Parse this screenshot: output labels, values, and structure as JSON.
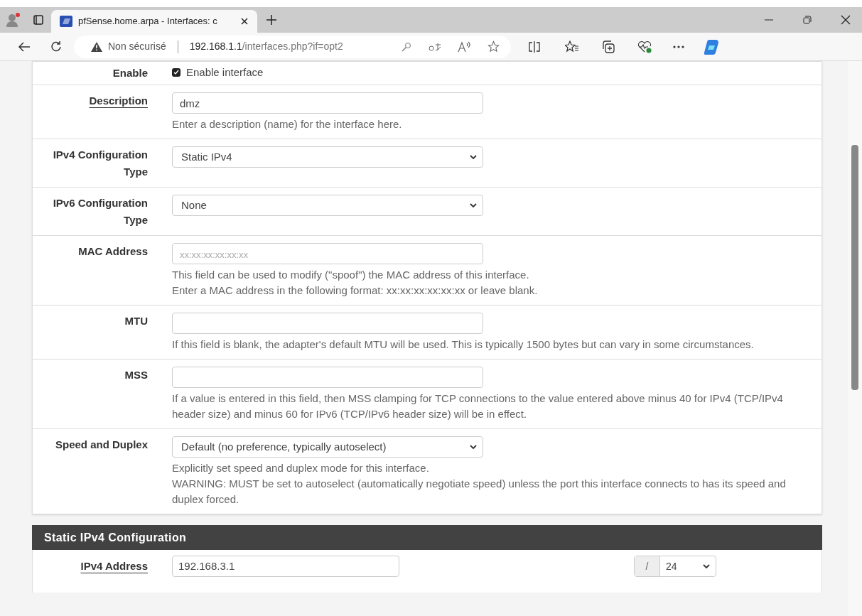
{
  "browser": {
    "tab_title": "pfSense.home.arpa - Interfaces: c",
    "security": "Non sécurisé",
    "url_host": "192.168.1.1",
    "url_path": "/interfaces.php?if=opt2"
  },
  "rows": [
    {
      "kind": "checkbox",
      "label": "Enable",
      "underlined": false,
      "checked": true,
      "text": "Enable interface",
      "help": []
    },
    {
      "kind": "text",
      "label": "Description",
      "underlined": true,
      "value": "dmz",
      "help": [
        "Enter a description (name) for the interface here."
      ]
    },
    {
      "kind": "select",
      "label": "IPv4 Configuration Type",
      "underlined": false,
      "value": "Static IPv4",
      "help": []
    },
    {
      "kind": "select",
      "label": "IPv6 Configuration Type",
      "underlined": false,
      "value": "None",
      "help": []
    },
    {
      "kind": "text",
      "label": "MAC Address",
      "underlined": false,
      "placeholder": "xx:xx:xx:xx:xx:xx",
      "help": [
        "This field can be used to modify (\"spoof\") the MAC address of this interface.",
        "Enter a MAC address in the following format: xx:xx:xx:xx:xx:xx or leave blank."
      ]
    },
    {
      "kind": "text",
      "label": "MTU",
      "underlined": false,
      "help": [
        "If this field is blank, the adapter's default MTU will be used. This is typically 1500 bytes but can vary in some circumstances."
      ]
    },
    {
      "kind": "text",
      "label": "MSS",
      "underlined": false,
      "help": [
        "If a value is entered in this field, then MSS clamping for TCP connections to the value entered above minus 40 for IPv4 (TCP/IPv4 header size) and minus 60 for IPv6 (TCP/IPv6 header size) will be in effect."
      ]
    },
    {
      "kind": "select",
      "label": "Speed and Duplex",
      "underlined": false,
      "value": "Default (no preference, typically autoselect)",
      "help": [
        "Explicitly set speed and duplex mode for this interface.",
        "WARNING: MUST be set to autoselect (automatically negotiate speed) unless the port this interface connects to has its speed and duplex forced."
      ]
    }
  ],
  "static_section": {
    "title": "Static IPv4 Configuration",
    "address_label": "IPv4 Address",
    "address_value": "192.168.3.1",
    "slash": "/",
    "prefix": "24"
  }
}
